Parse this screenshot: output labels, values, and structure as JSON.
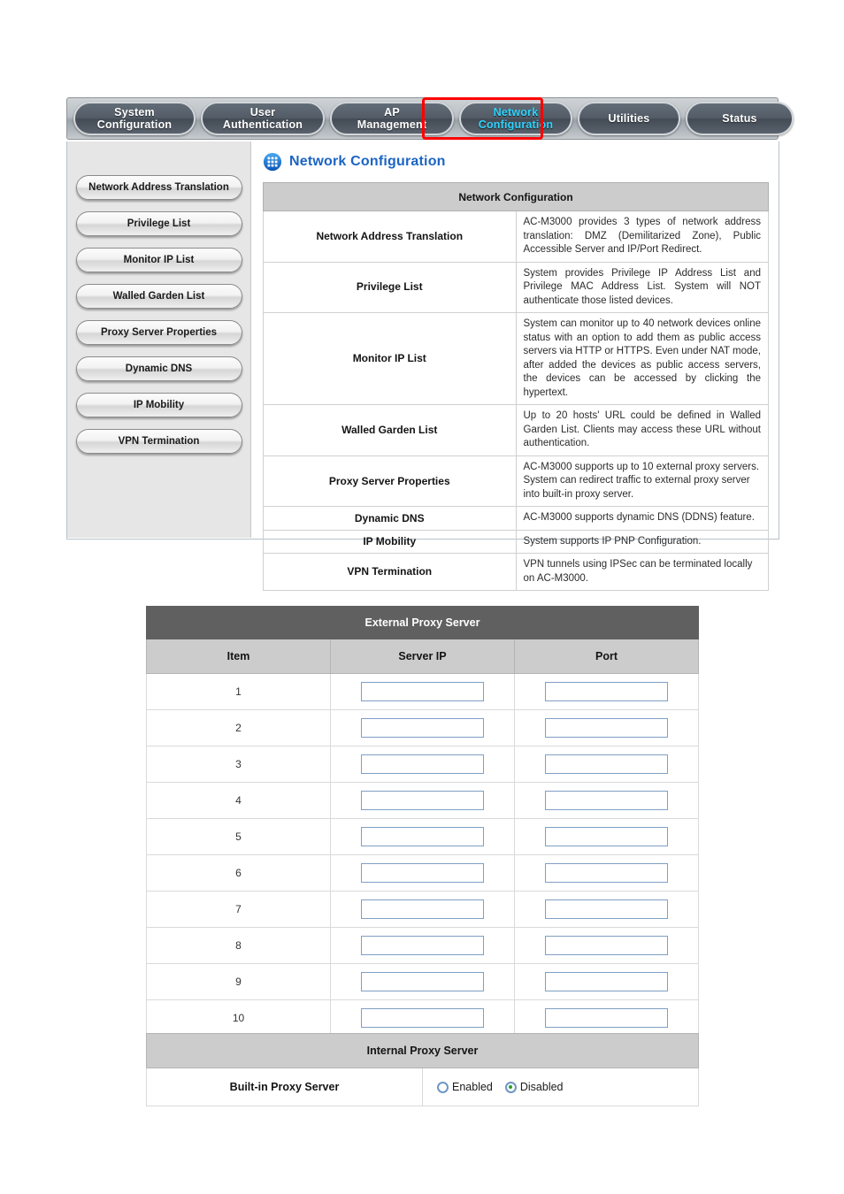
{
  "nav": {
    "tabs": [
      {
        "label": "System\nConfiguration",
        "active": false
      },
      {
        "label": "User\nAuthentication",
        "active": false
      },
      {
        "label": "AP\nManagement",
        "active": false
      },
      {
        "label": "Network\nConfiguration",
        "active": true
      },
      {
        "label": "Utilities",
        "active": false
      },
      {
        "label": "Status",
        "active": false
      }
    ],
    "highlight_color": "#ff0000",
    "active_text_color": "#2fd4ff"
  },
  "sidebar": {
    "items": [
      {
        "label": "Network Address Translation"
      },
      {
        "label": "Privilege List"
      },
      {
        "label": "Monitor IP List"
      },
      {
        "label": "Walled Garden List"
      },
      {
        "label": "Proxy Server Properties"
      },
      {
        "label": "Dynamic DNS"
      },
      {
        "label": "IP Mobility"
      },
      {
        "label": "VPN Termination"
      }
    ]
  },
  "page": {
    "title": "Network Configuration",
    "title_icon": "network-grid-icon",
    "title_color": "#1b64c4"
  },
  "overview_table": {
    "caption": "Network Configuration",
    "rows": [
      {
        "term": "Network Address Translation",
        "desc": "AC-M3000 provides 3 types of network address translation: DMZ (Demilitarized Zone), Public Accessible Server and IP/Port Redirect."
      },
      {
        "term": "Privilege List",
        "desc": "System provides Privilege IP Address List and Privilege MAC Address List. System will NOT authenticate those listed devices."
      },
      {
        "term": "Monitor IP List",
        "desc": "System can monitor up to 40 network devices online status with an option to add them as public access servers via HTTP or HTTPS. Even under NAT mode, after added the devices as public access servers, the devices can be accessed by clicking the hypertext."
      },
      {
        "term": "Walled Garden List",
        "desc": "Up to 20 hosts' URL could be defined in Walled Garden List. Clients may access these URL without authentication."
      },
      {
        "term": "Proxy Server Properties",
        "desc": "AC-M3000 supports up to 10 external proxy servers. System can redirect traffic to external proxy server into built-in proxy server."
      },
      {
        "term": "Dynamic DNS",
        "desc": "AC-M3000 supports dynamic DNS (DDNS) feature."
      },
      {
        "term": "IP Mobility",
        "desc": "System supports IP PNP Configuration."
      },
      {
        "term": "VPN Termination",
        "desc": "VPN tunnels using IPSec can be terminated locally on AC-M3000."
      }
    ]
  },
  "external_proxy": {
    "caption": "External Proxy Server",
    "columns": [
      "Item",
      "Server IP",
      "Port"
    ],
    "rows": [
      {
        "item": "1",
        "server_ip": "",
        "port": ""
      },
      {
        "item": "2",
        "server_ip": "",
        "port": ""
      },
      {
        "item": "3",
        "server_ip": "",
        "port": ""
      },
      {
        "item": "4",
        "server_ip": "",
        "port": ""
      },
      {
        "item": "5",
        "server_ip": "",
        "port": ""
      },
      {
        "item": "6",
        "server_ip": "",
        "port": ""
      },
      {
        "item": "7",
        "server_ip": "",
        "port": ""
      },
      {
        "item": "8",
        "server_ip": "",
        "port": ""
      },
      {
        "item": "9",
        "server_ip": "",
        "port": ""
      },
      {
        "item": "10",
        "server_ip": "",
        "port": ""
      }
    ]
  },
  "internal_proxy": {
    "caption": "Internal Proxy Server",
    "row_label": "Built-in Proxy Server",
    "options": [
      {
        "label": "Enabled",
        "selected": false
      },
      {
        "label": "Disabled",
        "selected": true
      }
    ],
    "selected_color": "#2a9e2a"
  }
}
